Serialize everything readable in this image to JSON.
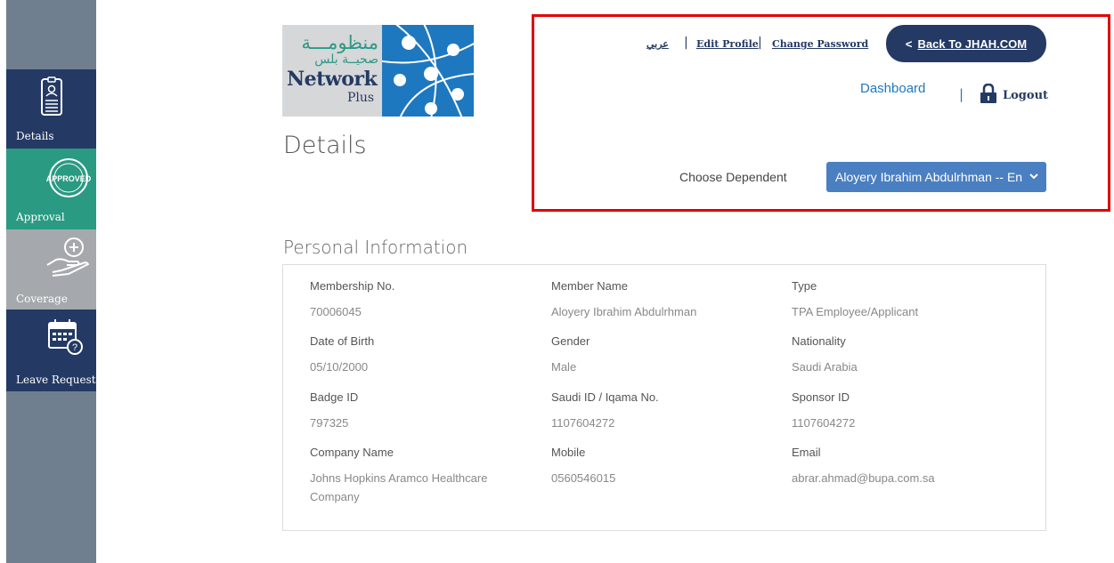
{
  "sidebar": {
    "items": [
      {
        "label": "Details",
        "icon": "id-card-icon"
      },
      {
        "label": "Approval",
        "icon": "approved-stamp-icon",
        "stamp_text": "APPROVED"
      },
      {
        "label": "Coverage",
        "icon": "hand-plus-icon"
      },
      {
        "label": "Leave Request",
        "icon": "calendar-question-icon"
      }
    ]
  },
  "logo": {
    "arabic_line1": "منظومـــة",
    "arabic_line2": "صحيــة بلس",
    "network": "Network",
    "plus": "Plus"
  },
  "page_title": "Details",
  "header": {
    "arabic_link": "عربي",
    "edit_profile": "Edit Profile",
    "change_password": "Change Password",
    "separator": "|",
    "back_button": "Back To JHAH.COM",
    "dashboard": "Dashboard",
    "logout": "Logout"
  },
  "dependent": {
    "label": "Choose Dependent",
    "selected": "Aloyery Ibrahim Abdulrhman -- En"
  },
  "personal_info": {
    "title": "Personal Information",
    "fields": [
      {
        "label": "Membership No.",
        "value": "70006045"
      },
      {
        "label": "Member Name",
        "value": "Aloyery Ibrahim Abdulrhman"
      },
      {
        "label": "Type",
        "value": "TPA Employee/Applicant"
      },
      {
        "label": "Date of Birth",
        "value": "05/10/2000"
      },
      {
        "label": "Gender",
        "value": "Male"
      },
      {
        "label": "Nationality",
        "value": "Saudi Arabia"
      },
      {
        "label": "Badge ID",
        "value": "797325"
      },
      {
        "label": "Saudi ID / Iqama No.",
        "value": "1107604272"
      },
      {
        "label": "Sponsor ID",
        "value": "1107604272"
      },
      {
        "label": "Company Name",
        "value": "Johns Hopkins Aramco Healthcare Company"
      },
      {
        "label": "Mobile",
        "value": "0560546015"
      },
      {
        "label": "Email",
        "value": "abrar.ahmad@bupa.com.sa"
      }
    ]
  },
  "colors": {
    "navy": "#243a64",
    "teal": "#2a9a82",
    "blue": "#1e78c0",
    "select_blue": "#4a7fc1",
    "highlight_red": "#e00000"
  }
}
